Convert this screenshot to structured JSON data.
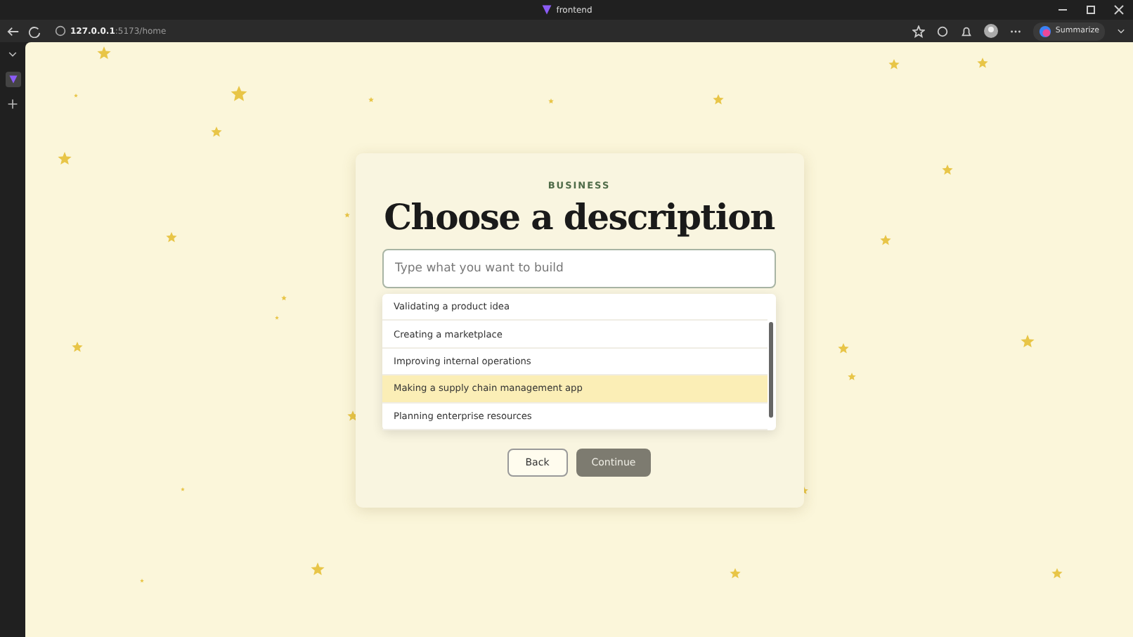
{
  "browser": {
    "tab_title": "frontend",
    "url_host": "127.0.0.1",
    "url_rest": ":5173/home",
    "summarize": "Summarize"
  },
  "card": {
    "eyebrow": "BUSINESS",
    "title": "Choose a description",
    "input": {
      "placeholder": "Type what you want to build"
    },
    "suggestions": [
      {
        "label": "Validating a product idea",
        "selected": false
      },
      {
        "label": "Creating a marketplace",
        "selected": false
      },
      {
        "label": "Improving internal operations",
        "selected": false
      },
      {
        "label": "Making a supply chain management app",
        "selected": true
      },
      {
        "label": "Planning enterprise resources",
        "selected": false
      }
    ],
    "buttons": [
      {
        "label": "Back",
        "kind": "secondary"
      },
      {
        "label": "Continue",
        "kind": "primary",
        "disabled": true
      }
    ]
  }
}
